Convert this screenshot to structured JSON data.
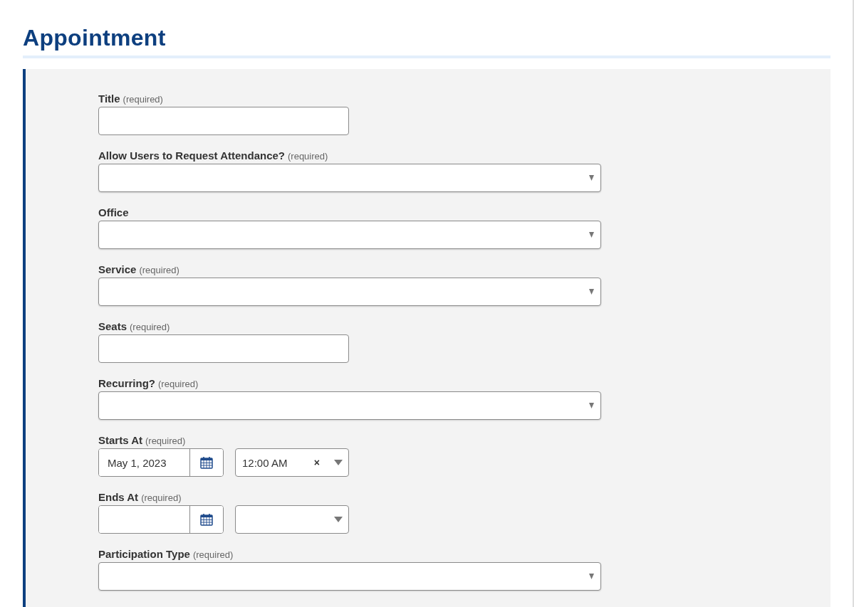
{
  "heading": "Appointment",
  "fields": [
    {
      "kind": "text",
      "label": "Title",
      "note": "(required)"
    },
    {
      "kind": "select",
      "label": "Allow Users to Request Attendance?",
      "note": "(required)"
    },
    {
      "kind": "select",
      "label": "Office"
    },
    {
      "kind": "select",
      "label": "Service",
      "note": "(required)"
    },
    {
      "kind": "text",
      "label": "Seats",
      "note": "(required)"
    },
    {
      "kind": "select",
      "label": "Recurring?",
      "note": "(required)"
    },
    {
      "kind": "datetime",
      "label": "Starts At",
      "note": "(required)",
      "date": "May 1, 2023",
      "time": "12:00 AM",
      "clear": "×"
    },
    {
      "kind": "datetime",
      "label": "Ends At",
      "note": "(required)"
    },
    {
      "kind": "select",
      "label": "Participation Type",
      "note": "(required)"
    }
  ]
}
